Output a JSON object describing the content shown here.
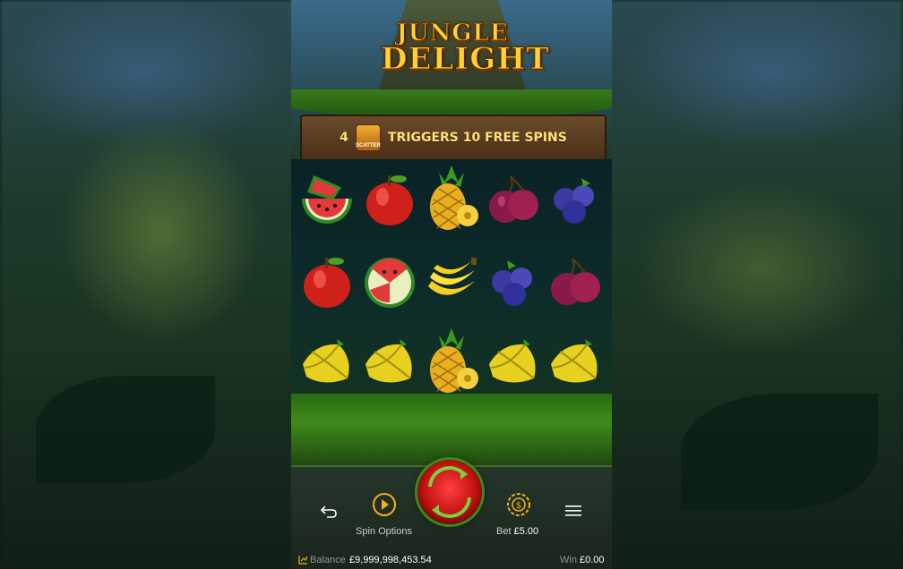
{
  "game": {
    "logo_line1": "JUNGLE",
    "logo_line2": "DELIGHT",
    "banner": {
      "count": "4",
      "scatter_label": "SCATTER",
      "text": "TRIGGERS 10 FREE SPINS"
    },
    "reels": [
      [
        "watermelon",
        "apple",
        "pineapple",
        "plum",
        "blueberry"
      ],
      [
        "apple",
        "watermelon",
        "banana",
        "blueberry",
        "plum"
      ],
      [
        "starfruit",
        "starfruit",
        "pineapple",
        "starfruit",
        "starfruit"
      ]
    ],
    "colors": {
      "banner_text": "#ffe27a",
      "spin_button": "#d01818",
      "accent_gold": "#f0b020"
    }
  },
  "controls": {
    "back_icon": "back-arrow-icon",
    "spin_options_label": "Spin Options",
    "spin_icon": "spin-icon",
    "bet_label": "Bet",
    "bet_value": "£5.00",
    "bet_icon": "coin-icon",
    "menu_icon": "hamburger-menu-icon"
  },
  "footer": {
    "balance_label": "Balance",
    "balance_value": "£9,999,998,453.54",
    "win_label": "Win",
    "win_value": "£0.00"
  }
}
